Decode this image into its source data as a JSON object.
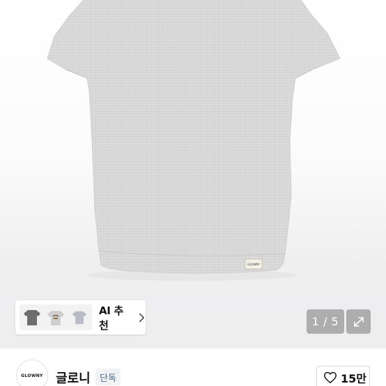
{
  "product_image": {
    "icon": "grey-tshirt-image",
    "label_tag_text": "GLOWNY"
  },
  "ai_recommend": {
    "label": "AI 추천",
    "thumbnails": [
      "dark-grey-tshirt-thumb",
      "graphic-tshirt-thumb",
      "light-grey-tshirt-thumb"
    ],
    "chevron_icon": "chevron-right-icon"
  },
  "gallery": {
    "counter": "1 / 5",
    "expand_icon": "expand-icon"
  },
  "brand": {
    "logo_text": "GLOWNY",
    "name": "글로니",
    "badge": "단독"
  },
  "like": {
    "icon": "heart-icon",
    "count": "15만"
  },
  "colors": {
    "shirt": "#d9d9d9",
    "badge_text": "#4a6a8a"
  }
}
